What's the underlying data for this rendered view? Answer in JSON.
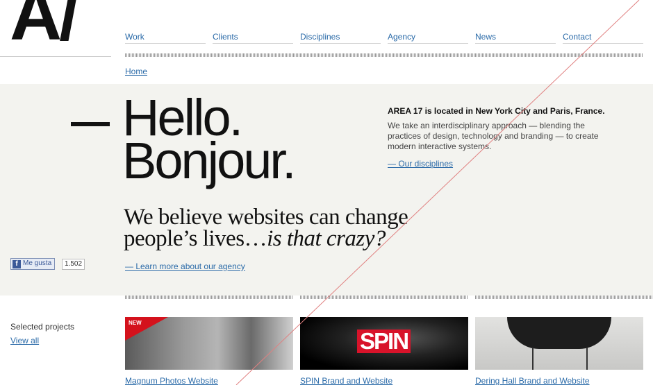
{
  "logo": {
    "text": "A/"
  },
  "nav": {
    "items": [
      "Work",
      "Clients",
      "Disciplines",
      "Agency",
      "News",
      "Contact"
    ]
  },
  "breadcrumb": {
    "home": "Home"
  },
  "hero": {
    "line1": "Hello.",
    "line2": "Bonjour.",
    "believe_line1": "We believe websites can change",
    "believe_line2": "people’s lives…",
    "believe_italic": "is that crazy?",
    "learn_more": "— Learn more about our agency"
  },
  "intro": {
    "heading": "AREA 17 is located in New York City and Paris, France.",
    "body": "We take an interdisciplinary approach — blending the practices of design, technology and branding — to create modern interactive systems.",
    "link": "— Our disciplines"
  },
  "facebook": {
    "like_label": "Me gusta",
    "like_count": "1.502",
    "icon": "facebook-icon"
  },
  "projects": {
    "heading": "Selected projects",
    "view_all": "View all",
    "items": [
      {
        "title": "Magnum Photos Website",
        "badge": "NEW"
      },
      {
        "title": "SPIN Brand and Website",
        "logo_text": "SPIN"
      },
      {
        "title": "Dering Hall Brand and Website"
      }
    ]
  },
  "colors": {
    "link": "#2a6aa8",
    "hero_bg": "#f3f3ef",
    "accent_red": "#d4121c"
  }
}
